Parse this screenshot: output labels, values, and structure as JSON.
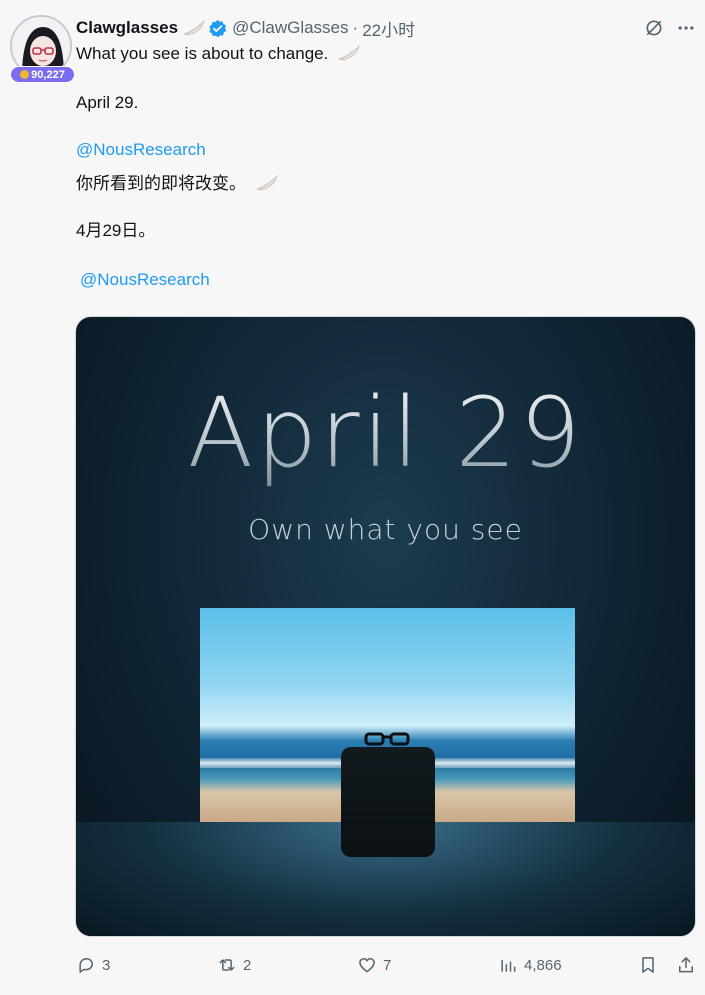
{
  "author": {
    "name": "Clawglasses",
    "handle": "@ClawGlasses",
    "separator": "·",
    "time": "22小时",
    "badge_count": "90,227"
  },
  "body": {
    "line1": "What you see is about to change.",
    "line2": "April 29.",
    "mention1": "@NousResearch",
    "line3": "你所看到的即将改变。",
    "line4": "4月29日。",
    "mention2": "@NousResearch"
  },
  "media": {
    "title": "April 29",
    "subtitle": "Own what you see"
  },
  "actions": {
    "replies": "3",
    "reposts": "2",
    "likes": "7",
    "views": "4,866"
  },
  "icons": [
    "grok-icon",
    "more-icon",
    "verified-icon",
    "wing-emoji",
    "reply-icon",
    "repost-icon",
    "like-icon",
    "views-icon",
    "bookmark-icon",
    "share-icon"
  ],
  "colors": {
    "accent": "#1d9bf0",
    "muted": "#536471",
    "badge": "#7c6cf0"
  }
}
